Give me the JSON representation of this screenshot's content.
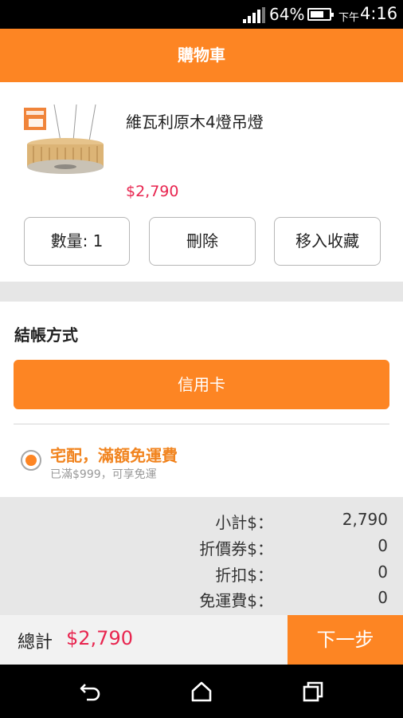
{
  "status_bar": {
    "battery_percent": "64%",
    "time_prefix": "下午",
    "time": "4:16"
  },
  "header": {
    "title": "購物車"
  },
  "cart_item": {
    "image_label": "維瓦利原木4燈吊燈 product image",
    "name": "維瓦利原木4燈吊燈",
    "price": "$2,790",
    "quantity_label": "數量: 1",
    "delete_label": "刪除",
    "move_to_favorites_label": "移入收藏"
  },
  "checkout": {
    "title": "結帳方式",
    "payment_method": "信用卡",
    "shipping_option": {
      "label": "宅配，滿額免運費",
      "sublabel": "已滿$999，可享免運",
      "selected": true
    }
  },
  "summary": {
    "rows": [
      {
        "label": "小計$：",
        "value": "2,790"
      },
      {
        "label": "折價券$：",
        "value": "0"
      },
      {
        "label": "折扣$：",
        "value": "0"
      },
      {
        "label": "免運費$：",
        "value": "0"
      }
    ]
  },
  "footer": {
    "total_label": "總計",
    "total_value": "$2,790",
    "next_label": "下一步"
  },
  "nav_bar": {
    "back_icon": "back-icon",
    "home_icon": "home-icon",
    "recents_icon": "recents-icon"
  },
  "colors": {
    "accent": "#fd8523",
    "price": "#e8254f"
  }
}
